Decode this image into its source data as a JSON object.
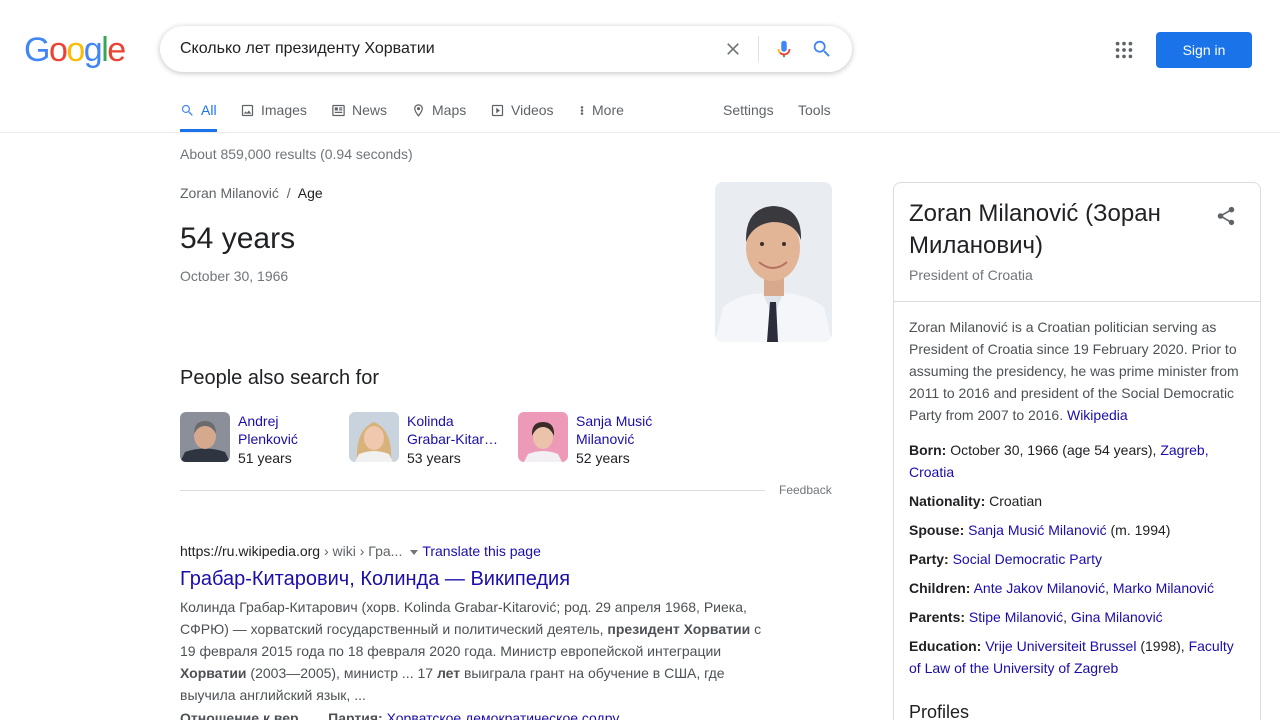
{
  "logo": {
    "letters": [
      "G",
      "o",
      "o",
      "g",
      "l",
      "e"
    ],
    "colors": [
      "#4285f4",
      "#ea4335",
      "#fbbc05",
      "#4285f4",
      "#34a853",
      "#ea4335"
    ]
  },
  "search": {
    "query": "Сколько лет президенту Хорватии"
  },
  "header": {
    "signin_label": "Sign in"
  },
  "tabs": {
    "all": "All",
    "images": "Images",
    "news": "News",
    "maps": "Maps",
    "videos": "Videos",
    "more": "More",
    "settings": "Settings",
    "tools": "Tools"
  },
  "stats": "About 859,000 results (0.94 seconds)",
  "answer": {
    "entity": "Zoran Milanović",
    "sep": "/",
    "attribute": "Age",
    "value": "54 years",
    "date": "October 30, 1966"
  },
  "pasf": {
    "title": "People also search for",
    "items": [
      {
        "name": "Andrej Plenković",
        "age": "51 years"
      },
      {
        "name": "Kolinda Grabar-Kitar…",
        "name_line1": "Kolinda",
        "name_line2": "Grabar-Kitar…",
        "age": "53 years"
      },
      {
        "name": "Sanja Musić Milanović",
        "age": "52 years"
      }
    ],
    "feedback": "Feedback"
  },
  "result": {
    "url": "https://ru.wikipedia.org",
    "breadcrumb": " › wiki › Гра...",
    "translate": "Translate this page",
    "title": "Грабар-Китарович, Колинда — Википедия",
    "snippet": [
      {
        "t": "Колинда Грабар-Китарович (хорв. Kolinda Grabar-Kitarović; род. 29 апреля 1968, Риека, СФРЮ) — хорватский государственный и политический деятель, ",
        "b": false
      },
      {
        "t": "президент Хорватии",
        "b": true
      },
      {
        "t": " с 19 февраля 2015 года по 18 февраля 2020 года. Министр европейской интеграции ",
        "b": false
      },
      {
        "t": "Хорватии",
        "b": true
      },
      {
        "t": " (2003—2005), министр ... 17 ",
        "b": false
      },
      {
        "t": "лет",
        "b": true
      },
      {
        "t": " выиграла грант на обучение в США, где выучила английский язык, ...",
        "b": false
      }
    ],
    "sitelinks_label": "Отношение к вер...",
    "sitelinks_party_label": "Партия:",
    "sitelinks_party": "Хорватское демократическое содру..."
  },
  "kp": {
    "title": "Zoran Milanović (Зоран Миланович)",
    "subtitle": "President of Croatia",
    "description": "Zoran Milanović is a Croatian politician serving as President of Croatia since 19 February 2020. Prior to assuming the presidency, he was prime minister from 2011 to 2016 and president of the Social Democratic Party from 2007 to 2016. ",
    "source": "Wikipedia",
    "facts": [
      {
        "label": "Born:",
        "parts": [
          {
            "t": " October 30, 1966 (age 54 years), ",
            "l": false
          },
          {
            "t": "Zagreb, Croatia",
            "l": true
          }
        ]
      },
      {
        "label": "Nationality:",
        "parts": [
          {
            "t": " Croatian",
            "l": false
          }
        ]
      },
      {
        "label": "Spouse:",
        "parts": [
          {
            "t": " ",
            "l": false
          },
          {
            "t": "Sanja Musić Milanović",
            "l": true
          },
          {
            "t": " (m. 1994)",
            "l": false
          }
        ]
      },
      {
        "label": "Party:",
        "parts": [
          {
            "t": " ",
            "l": false
          },
          {
            "t": "Social Democratic Party",
            "l": true
          }
        ]
      },
      {
        "label": "Children:",
        "parts": [
          {
            "t": " ",
            "l": false
          },
          {
            "t": "Ante Jakov Milanović",
            "l": true
          },
          {
            "t": ", ",
            "l": false
          },
          {
            "t": "Marko Milanović",
            "l": true
          }
        ]
      },
      {
        "label": "Parents:",
        "parts": [
          {
            "t": " ",
            "l": false
          },
          {
            "t": "Stipe Milanović",
            "l": true
          },
          {
            "t": ", ",
            "l": false
          },
          {
            "t": "Gina Milanović",
            "l": true
          }
        ]
      },
      {
        "label": "Education:",
        "parts": [
          {
            "t": " ",
            "l": false
          },
          {
            "t": "Vrije Universiteit Brussel",
            "l": true
          },
          {
            "t": " (1998), ",
            "l": false
          },
          {
            "t": "Faculty of Law of the University of Zagreb",
            "l": true
          }
        ]
      }
    ],
    "profiles": "Profiles"
  },
  "colors": {
    "link": "#1a0dab",
    "accent": "#1a73e8",
    "text": "#202124",
    "muted": "#70757a"
  }
}
